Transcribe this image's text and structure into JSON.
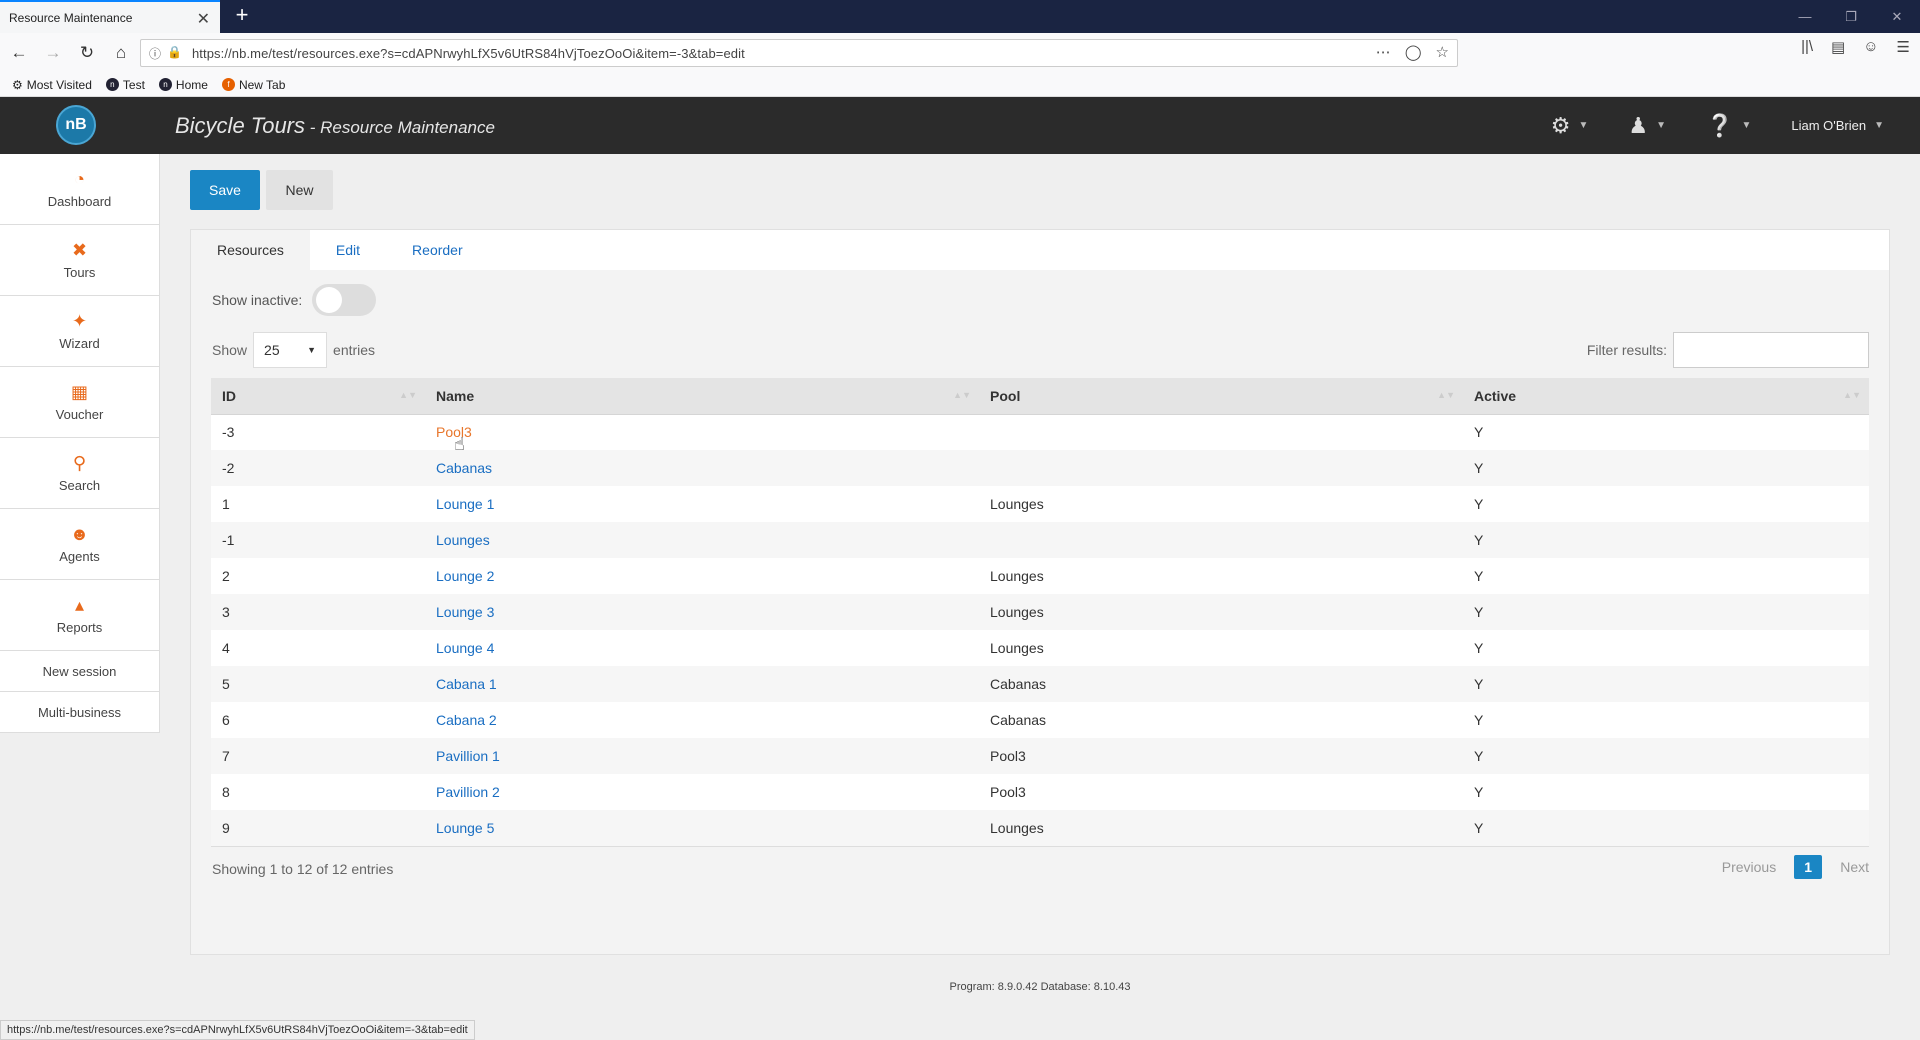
{
  "browser": {
    "tab_title": "Resource Maintenance",
    "tab_close": "✕",
    "new_tab": "+",
    "url": "https://nb.me/test/resources.exe?s=cdAPNrwyhLfX5v6UtRS84hVjToezOoOi&item=-3&tab=edit",
    "bookmarks": [
      {
        "label": "Most Visited",
        "icon": "gear-icon"
      },
      {
        "label": "Test",
        "icon": "nb-icon"
      },
      {
        "label": "Home",
        "icon": "nb-icon"
      },
      {
        "label": "New Tab",
        "icon": "firefox-icon"
      }
    ],
    "status_url": "https://nb.me/test/resources.exe?s=cdAPNrwyhLfX5v6UtRS84hVjToezOoOi&item=-3&tab=edit"
  },
  "app": {
    "logo": "nB",
    "title": "Bicycle Tours",
    "subtitle": " - Resource Maintenance",
    "user": "Liam O'Brien"
  },
  "sidebar": {
    "items": [
      {
        "label": "Dashboard",
        "icon": "dashboard-icon"
      },
      {
        "label": "Tours",
        "icon": "tours-icon"
      },
      {
        "label": "Wizard",
        "icon": "wand-icon"
      },
      {
        "label": "Voucher",
        "icon": "gift-icon"
      },
      {
        "label": "Search",
        "icon": "search-icon"
      },
      {
        "label": "Agents",
        "icon": "agent-icon"
      },
      {
        "label": "Reports",
        "icon": "chart-icon"
      }
    ],
    "links": [
      "New session",
      "Multi-business"
    ]
  },
  "toolbar": {
    "save_label": "Save",
    "new_label": "New"
  },
  "tabs": [
    "Resources",
    "Edit",
    "Reorder"
  ],
  "filters": {
    "show_inactive": "Show inactive:",
    "show": "Show",
    "entries_value": "25",
    "entries": "entries",
    "filter_label": "Filter results:"
  },
  "table": {
    "columns": [
      "ID",
      "Name",
      "Pool",
      "Active"
    ],
    "rows": [
      {
        "id": "-3",
        "name": "Pool3",
        "pool": "",
        "active": "Y"
      },
      {
        "id": "-2",
        "name": "Cabanas",
        "pool": "",
        "active": "Y"
      },
      {
        "id": "1",
        "name": "Lounge 1",
        "pool": "Lounges",
        "active": "Y"
      },
      {
        "id": "-1",
        "name": "Lounges",
        "pool": "",
        "active": "Y"
      },
      {
        "id": "2",
        "name": "Lounge 2",
        "pool": "Lounges",
        "active": "Y"
      },
      {
        "id": "3",
        "name": "Lounge 3",
        "pool": "Lounges",
        "active": "Y"
      },
      {
        "id": "4",
        "name": "Lounge 4",
        "pool": "Lounges",
        "active": "Y"
      },
      {
        "id": "5",
        "name": "Cabana 1",
        "pool": "Cabanas",
        "active": "Y"
      },
      {
        "id": "6",
        "name": "Cabana 2",
        "pool": "Cabanas",
        "active": "Y"
      },
      {
        "id": "7",
        "name": "Pavillion 1",
        "pool": "Pool3",
        "active": "Y"
      },
      {
        "id": "8",
        "name": "Pavillion 2",
        "pool": "Pool3",
        "active": "Y"
      },
      {
        "id": "9",
        "name": "Lounge 5",
        "pool": "Lounges",
        "active": "Y"
      }
    ]
  },
  "pagination": {
    "info": "Showing 1 to 12 of 12 entries",
    "previous": "Previous",
    "current": "1",
    "next": "Next"
  },
  "footer": "Program: 8.9.0.42 Database: 8.10.43",
  "colors": {
    "accent": "#1a86c4",
    "header": "#2b2b2b",
    "link": "#1a6ec2",
    "hover_link": "#e8762b",
    "sidebar_icon": "#e86a1c"
  }
}
